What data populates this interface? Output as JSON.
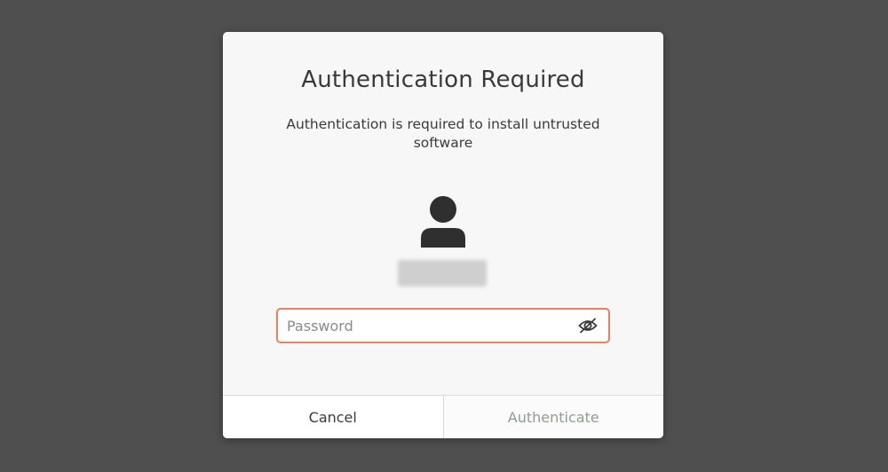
{
  "dialog": {
    "title": "Authentication Required",
    "message": "Authentication is required to install untrusted software",
    "avatar_icon": "user-icon",
    "username": "",
    "password": {
      "value": "",
      "placeholder": "Password",
      "reveal_icon": "eye-slash-icon"
    },
    "buttons": {
      "cancel_label": "Cancel",
      "authenticate_label": "Authenticate"
    }
  },
  "colors": {
    "backdrop": "#4f4f4f",
    "dialog_bg": "#f7f7f7",
    "focus_border": "#e7825a",
    "disabled_text": "#8f9e8f"
  }
}
